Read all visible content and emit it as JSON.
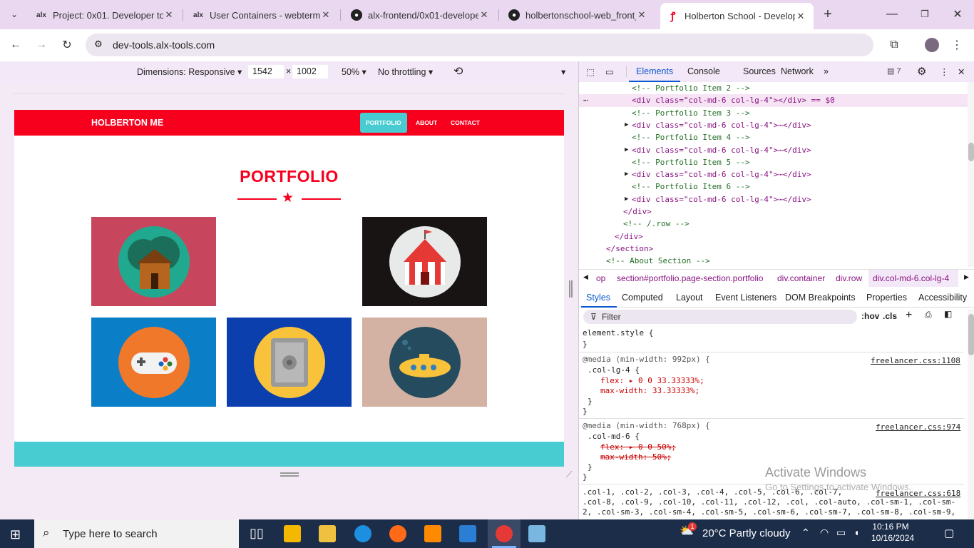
{
  "tabs": [
    {
      "label": "Project: 0x01. Developer too",
      "icon": "alx"
    },
    {
      "label": "User Containers - webterm |",
      "icon": "alx"
    },
    {
      "label": "alx-frontend/0x01-develope",
      "icon": "github"
    },
    {
      "label": "holbertonschool-web_front_",
      "icon": "github"
    },
    {
      "label": "Holberton School - Develop",
      "icon": "holberton"
    }
  ],
  "address": {
    "url": "dev-tools.alx-tools.com"
  },
  "device_toolbar": {
    "dimensions": "Dimensions: Responsive",
    "width": "1542",
    "times": "×",
    "height": "1002",
    "zoom": "50%",
    "throttling": "No throttling"
  },
  "site": {
    "brand": "HOLBERTON ME",
    "nav": [
      "PORTFOLIO",
      "ABOUT",
      "CONTACT"
    ],
    "title": "PORTFOLIO"
  },
  "devtools": {
    "tabs": [
      "Elements",
      "Console",
      "Sources",
      "Network"
    ],
    "issues": "7",
    "dom": [
      "<!-- Portfolio Item 2 -->",
      "<div class=\"col-md-6 col-lg-4\"></div> == $0",
      "<!-- Portfolio Item 3 -->",
      "<div class=\"col-md-6 col-lg-4\">⋯</div>",
      "<!-- Portfolio Item 4 -->",
      "<div class=\"col-md-6 col-lg-4\">⋯</div>",
      "<!-- Portfolio Item 5 -->",
      "<div class=\"col-md-6 col-lg-4\">⋯</div>",
      "<!-- Portfolio Item 6 -->",
      "<div class=\"col-md-6 col-lg-4\">⋯</div>",
      "</div>",
      "<!-- /.row -->",
      "</div>",
      "</section>",
      "<!-- About Section -->"
    ],
    "breadcrumbs": [
      "op",
      "section#portfolio.page-section.portfolio",
      "div.container",
      "div.row",
      "div.col-md-6.col-lg-4"
    ],
    "style_tabs": [
      "Styles",
      "Computed",
      "Layout",
      "Event Listeners",
      "DOM Breakpoints",
      "Properties",
      "Accessibility"
    ],
    "filter_placeholder": "Filter",
    "hov": ":hov",
    "cls": ".cls",
    "styles": {
      "element_style": "element.style {",
      "close": "}",
      "media1": "@media (min-width: 992px) {",
      "sel1": ".col-lg-4 {",
      "p1": "flex: ▸ 0 0 33.33333%;",
      "p2": "max-width: 33.33333%;",
      "link1": "freelancer.css:1108",
      "media2": "@media (min-width: 768px) {",
      "sel2": ".col-md-6 {",
      "p3": "flex: ▸ 0 0 50%;",
      "p4": "max-width: 50%;",
      "link2": "freelancer.css:974",
      "cols1": ".col-1, .col-2, .col-3, .col-4, .col-5, .col-6, .col-7,",
      "cols2": ".col-8, .col-9, .col-10, .col-11, .col-12, .col, .col-auto, .col-sm-1, .col-sm-",
      "cols3": "2, .col-sm-3, .col-sm-4, .col-sm-5, .col-sm-6, .col-sm-7, .col-sm-8, .col-sm-9,",
      "link3": "freelancer.css:618"
    }
  },
  "watermark": {
    "line1": "Activate Windows",
    "line2": "Go to Settings to activate Windows."
  },
  "taskbar": {
    "search": "Type here to search",
    "weather": "20°C  Partly cloudy",
    "time": "10:16 PM",
    "date": "10/16/2024",
    "badge": "1"
  },
  "colors": {
    "brand_red": "#f7001e",
    "teal": "#48cbd1",
    "tab_strip": "#e9d8f0"
  }
}
